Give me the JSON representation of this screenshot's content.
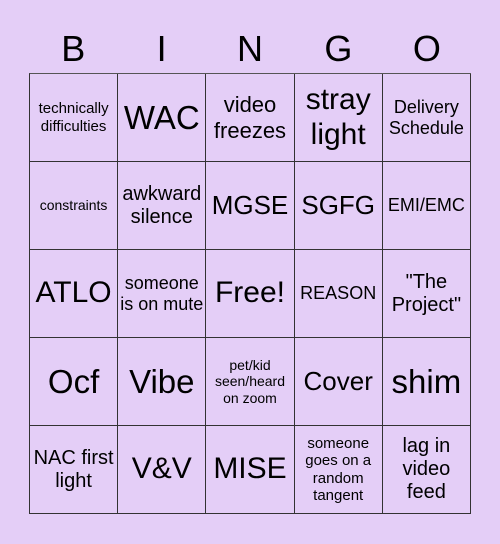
{
  "header": [
    "B",
    "I",
    "N",
    "G",
    "O"
  ],
  "cells": [
    [
      "technically difficulties",
      "WAC",
      "video freezes",
      "stray light",
      "Delivery Schedule"
    ],
    [
      "constraints",
      "awkward silence",
      "MGSE",
      "SGFG",
      "EMI/EMC"
    ],
    [
      "ATLO",
      "someone is on mute",
      "Free!",
      "REASON",
      "\"The Project\""
    ],
    [
      "Ocf",
      "Vibe",
      "pet/kid seen/heard on zoom",
      "Cover",
      "shim"
    ],
    [
      "NAC first light",
      "V&V",
      "MISE",
      "someone goes on a random tangent",
      "lag in video feed"
    ]
  ],
  "colors": {
    "background": "#E4CEF7",
    "grid_line": "#333333",
    "text": "#000000"
  }
}
